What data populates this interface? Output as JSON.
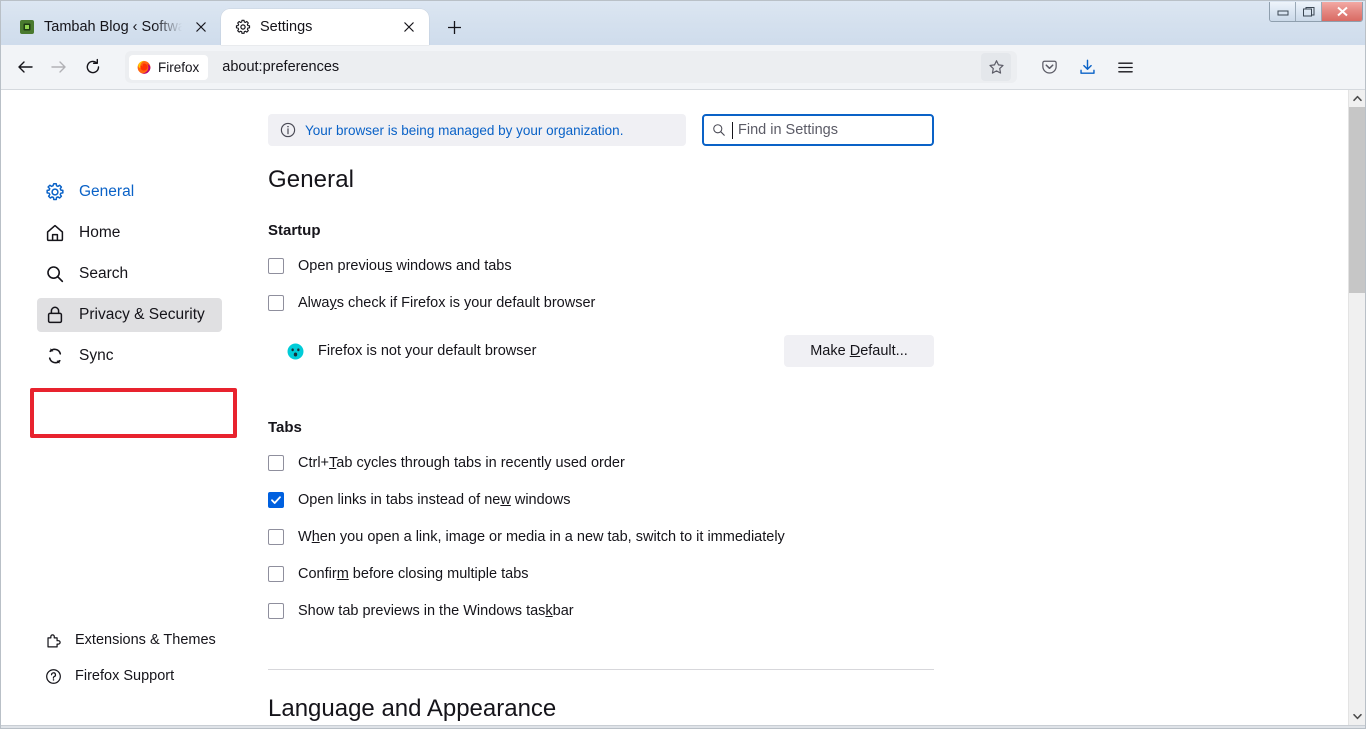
{
  "window": {
    "controls": {
      "minimize": "minimize-button",
      "restore": "restore-button",
      "close": "close-button"
    }
  },
  "tabs": [
    {
      "title": "Tambah Blog ‹ Software dan Tek",
      "favicon": "site-favicon",
      "active": false
    },
    {
      "title": "Settings",
      "favicon": "gear-icon",
      "active": true
    }
  ],
  "newtab_label": "+",
  "toolbar": {
    "back": "back-icon",
    "forward": "forward-icon",
    "reload": "reload-icon",
    "identity_label": "Firefox",
    "url": "about:preferences",
    "bookmark": "star-icon",
    "pocket": "pocket-icon",
    "downloads": "download-icon",
    "menu": "hamburger-icon"
  },
  "sidebar": {
    "items": [
      {
        "label": "General",
        "icon": "gear-icon",
        "state": "active"
      },
      {
        "label": "Home",
        "icon": "home-icon",
        "state": "normal"
      },
      {
        "label": "Search",
        "icon": "magnifier-icon",
        "state": "normal"
      },
      {
        "label": "Privacy & Security",
        "icon": "lock-icon",
        "state": "highlighted"
      },
      {
        "label": "Sync",
        "icon": "sync-icon",
        "state": "normal"
      }
    ],
    "footer": [
      {
        "label": "Extensions & Themes",
        "icon": "puzzle-icon"
      },
      {
        "label": "Firefox Support",
        "icon": "question-circle-icon"
      }
    ],
    "highlight_color": "#e8232e"
  },
  "notice": {
    "icon": "info-circle-icon",
    "text": "Your browser is being managed by your organization.",
    "color": "#0a62c7"
  },
  "search": {
    "icon": "search-icon",
    "placeholder": "Find in Settings",
    "value": "",
    "focused": true,
    "border_color": "#0a62c7"
  },
  "main": {
    "title": "General",
    "startup": {
      "heading": "Startup",
      "options": [
        {
          "label_pre": "Open previou",
          "label_key": "s",
          "label_post": " windows and tabs",
          "checked": false
        },
        {
          "label_pre": "Alwa",
          "label_key": "y",
          "label_post": "s check if Firefox is your default browser",
          "checked": false
        }
      ],
      "default_status": "Firefox is not your default browser",
      "default_status_icon": "firefox-alert-face-icon",
      "make_default_pre": "Make ",
      "make_default_key": "D",
      "make_default_post": "efault..."
    },
    "tabs_section": {
      "heading": "Tabs",
      "options": [
        {
          "label_pre": "Ctrl+",
          "label_key": "T",
          "label_post": "ab cycles through tabs in recently used order",
          "checked": false
        },
        {
          "label_pre": "Open links in tabs instead of ne",
          "label_key": "w",
          "label_post": " windows",
          "checked": true
        },
        {
          "label_pre": "W",
          "label_key": "h",
          "label_post": "en you open a link, image or media in a new tab, switch to it immediately",
          "checked": false
        },
        {
          "label_pre": "Confir",
          "label_key": "m",
          "label_post": " before closing multiple tabs",
          "checked": false
        },
        {
          "label_pre": "Show tab previews in the Windows tas",
          "label_key": "k",
          "label_post": "bar",
          "checked": false
        }
      ]
    },
    "next_section_title": "Language and Appearance"
  },
  "scrollbar": {
    "up": "scroll-up-arrow",
    "down": "scroll-down-arrow",
    "thumb": "scroll-thumb"
  }
}
